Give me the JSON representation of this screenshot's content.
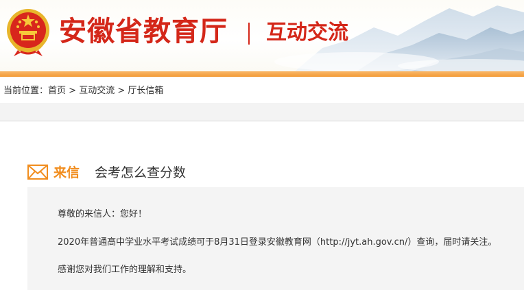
{
  "header": {
    "site_title": "安徽省教育厅",
    "section_title": "互动交流"
  },
  "breadcrumb": {
    "prefix": "当前位置：",
    "items": [
      "首页",
      "互动交流",
      "厅长信箱"
    ],
    "separator": ">"
  },
  "letter": {
    "label": "来信",
    "subject": "会考怎么查分数",
    "icon": "envelope-icon"
  },
  "reply": {
    "greeting": "尊敬的来信人：您好！",
    "body": "2020年普通高中学业水平考试成绩可于8月31日登录安徽教育网（http://jyt.ah.gov.cn/）查询，届时请关注。",
    "thanks": "感谢您对我们工作的理解和支持。"
  },
  "colors": {
    "brand_red": "#d42719",
    "accent_orange": "#f18d1e",
    "bar_orange": "#f39a35"
  }
}
